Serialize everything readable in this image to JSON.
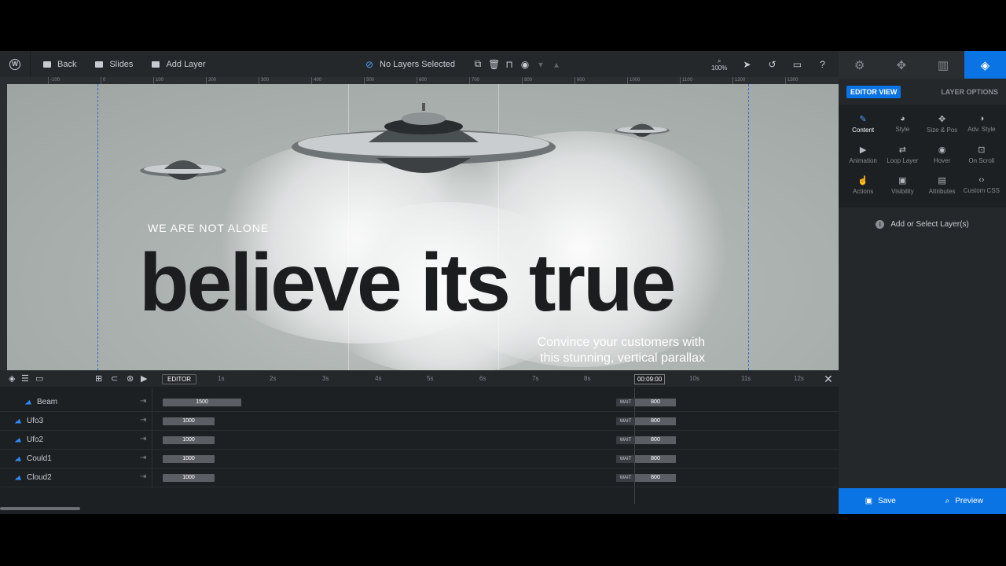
{
  "toolbar": {
    "wp_logo": "W",
    "back": "Back",
    "slides": "Slides",
    "add_layer": "Add Layer",
    "layer_status": "No Layers Selected",
    "zoom": "100%"
  },
  "panel": {
    "editor_view": "EDITOR VIEW",
    "layer_options": "LAYER OPTIONS",
    "options": [
      {
        "label": "Content",
        "icon": "✎"
      },
      {
        "label": "Style",
        "icon": "◕"
      },
      {
        "label": "Size & Pos",
        "icon": "✥"
      },
      {
        "label": "Adv. Style",
        "icon": "◑"
      },
      {
        "label": "Animation",
        "icon": "▶"
      },
      {
        "label": "Loop Layer",
        "icon": "⇄"
      },
      {
        "label": "Hover",
        "icon": "◉"
      },
      {
        "label": "On Scroll",
        "icon": "⊡"
      },
      {
        "label": "Actions",
        "icon": "☝"
      },
      {
        "label": "Visibility",
        "icon": "▣"
      },
      {
        "label": "Attributes",
        "icon": "▤"
      },
      {
        "label": "Custom CSS",
        "icon": "‹›"
      }
    ],
    "empty_message": "Add or Select Layer(s)",
    "info_glyph": "i",
    "save": "Save",
    "preview": "Preview"
  },
  "ruler": [
    "-100",
    "0",
    "100",
    "200",
    "300",
    "400",
    "500",
    "600",
    "700",
    "800",
    "900",
    "1000",
    "1100",
    "1200",
    "1300"
  ],
  "canvas": {
    "kicker": "WE ARE NOT ALONE",
    "headline": "believe its true",
    "subtext_line1": "Convince your customers with",
    "subtext_line2": "this stunning, vertical parallax"
  },
  "timeline": {
    "editor_tag": "EDITOR",
    "ticks": [
      "1s",
      "2s",
      "3s",
      "4s",
      "5s",
      "6s",
      "7s",
      "8s",
      "10s",
      "11s",
      "12s"
    ],
    "current_time": "00:09:00",
    "rows": [
      {
        "name": "Beam",
        "in": "1500",
        "wait": "WAIT",
        "out": "800"
      },
      {
        "name": "Ufo3",
        "in": "1000",
        "wait": "WAIT",
        "out": "800"
      },
      {
        "name": "Ufo2",
        "in": "1000",
        "wait": "WAIT",
        "out": "800"
      },
      {
        "name": "Could1",
        "in": "1000",
        "wait": "WAIT",
        "out": "800"
      },
      {
        "name": "Cloud2",
        "in": "1000",
        "wait": "WAIT",
        "out": "800"
      }
    ]
  },
  "colors": {
    "accent": "#0b74e5",
    "background": "#1d2022",
    "panel": "#25282b"
  }
}
